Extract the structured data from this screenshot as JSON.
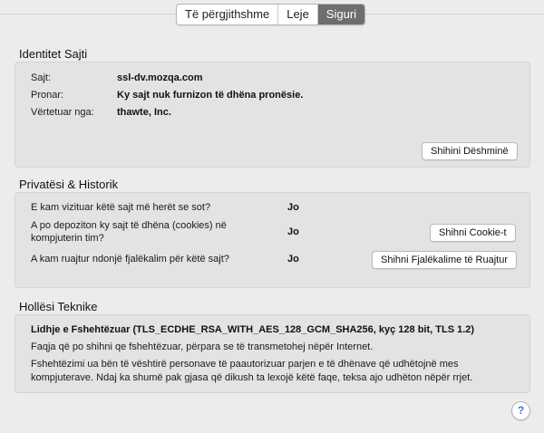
{
  "tabs": [
    {
      "label": "Të përgjithshme",
      "active": false
    },
    {
      "label": "Leje",
      "active": false
    },
    {
      "label": "Siguri",
      "active": true
    }
  ],
  "identity": {
    "title": "Identitet Sajti",
    "site_label": "Sajt:",
    "site_value": "ssl-dv.mozqa.com",
    "owner_label": "Pronar:",
    "owner_value": "Ky sajt nuk furnizon të dhëna pronësie.",
    "verified_label": "Vërtetuar nga:",
    "verified_value": "thawte, Inc.",
    "view_cert_button": "Shihini Dëshminë"
  },
  "privacy": {
    "title": "Privatësi & Historik",
    "q1": "E kam vizituar këtë sajt më herët se sot?",
    "a1": "Jo",
    "q2": "A po depoziton ky sajt të dhëna (cookies) në kompjuterin tim?",
    "a2": "Jo",
    "cookies_button": "Shihni Cookie-t",
    "q3": "A kam ruajtur ndonjë fjalëkalim për këtë sajt?",
    "a3": "Jo",
    "passwords_button": "Shihni Fjalëkalime të Ruajtur"
  },
  "technical": {
    "title": "Hollësi Teknike",
    "heading": "Lidhje e Fshehtëzuar (TLS_ECDHE_RSA_WITH_AES_128_GCM_SHA256, kyç 128 bit, TLS 1.2)",
    "line1": "Faqja që po shihni qe fshehtëzuar, përpara se të transmetohej nëpër Internet.",
    "line2": "Fshehtëzimi ua bën të vështirë personave të paautorizuar parjen e të dhënave që udhëtojnë mes kompjuterave. Ndaj ka shumë pak gjasa që dikush ta lexojë këtë faqe, teksa ajo udhëton nëpër rrjet."
  },
  "help_button": "?",
  "colors": {
    "window_bg": "#ececec",
    "box_bg": "#e3e3e3",
    "active_tab": "#6e6e6e",
    "help_glyph": "#3a7be0"
  }
}
